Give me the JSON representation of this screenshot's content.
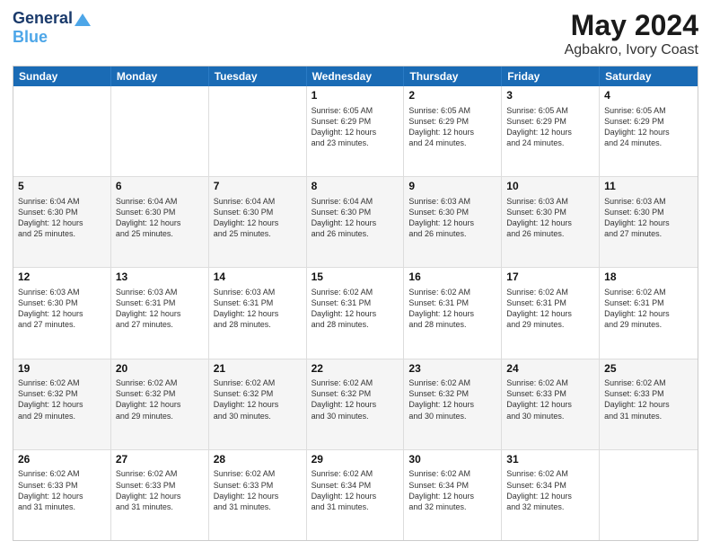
{
  "header": {
    "logo_line1": "General",
    "logo_line2": "Blue",
    "title": "May 2024",
    "subtitle": "Agbakro, Ivory Coast"
  },
  "weekdays": [
    "Sunday",
    "Monday",
    "Tuesday",
    "Wednesday",
    "Thursday",
    "Friday",
    "Saturday"
  ],
  "weeks": [
    [
      {
        "day": "",
        "info": ""
      },
      {
        "day": "",
        "info": ""
      },
      {
        "day": "",
        "info": ""
      },
      {
        "day": "1",
        "info": "Sunrise: 6:05 AM\nSunset: 6:29 PM\nDaylight: 12 hours\nand 23 minutes."
      },
      {
        "day": "2",
        "info": "Sunrise: 6:05 AM\nSunset: 6:29 PM\nDaylight: 12 hours\nand 24 minutes."
      },
      {
        "day": "3",
        "info": "Sunrise: 6:05 AM\nSunset: 6:29 PM\nDaylight: 12 hours\nand 24 minutes."
      },
      {
        "day": "4",
        "info": "Sunrise: 6:05 AM\nSunset: 6:29 PM\nDaylight: 12 hours\nand 24 minutes."
      }
    ],
    [
      {
        "day": "5",
        "info": "Sunrise: 6:04 AM\nSunset: 6:30 PM\nDaylight: 12 hours\nand 25 minutes."
      },
      {
        "day": "6",
        "info": "Sunrise: 6:04 AM\nSunset: 6:30 PM\nDaylight: 12 hours\nand 25 minutes."
      },
      {
        "day": "7",
        "info": "Sunrise: 6:04 AM\nSunset: 6:30 PM\nDaylight: 12 hours\nand 25 minutes."
      },
      {
        "day": "8",
        "info": "Sunrise: 6:04 AM\nSunset: 6:30 PM\nDaylight: 12 hours\nand 26 minutes."
      },
      {
        "day": "9",
        "info": "Sunrise: 6:03 AM\nSunset: 6:30 PM\nDaylight: 12 hours\nand 26 minutes."
      },
      {
        "day": "10",
        "info": "Sunrise: 6:03 AM\nSunset: 6:30 PM\nDaylight: 12 hours\nand 26 minutes."
      },
      {
        "day": "11",
        "info": "Sunrise: 6:03 AM\nSunset: 6:30 PM\nDaylight: 12 hours\nand 27 minutes."
      }
    ],
    [
      {
        "day": "12",
        "info": "Sunrise: 6:03 AM\nSunset: 6:30 PM\nDaylight: 12 hours\nand 27 minutes."
      },
      {
        "day": "13",
        "info": "Sunrise: 6:03 AM\nSunset: 6:31 PM\nDaylight: 12 hours\nand 27 minutes."
      },
      {
        "day": "14",
        "info": "Sunrise: 6:03 AM\nSunset: 6:31 PM\nDaylight: 12 hours\nand 28 minutes."
      },
      {
        "day": "15",
        "info": "Sunrise: 6:02 AM\nSunset: 6:31 PM\nDaylight: 12 hours\nand 28 minutes."
      },
      {
        "day": "16",
        "info": "Sunrise: 6:02 AM\nSunset: 6:31 PM\nDaylight: 12 hours\nand 28 minutes."
      },
      {
        "day": "17",
        "info": "Sunrise: 6:02 AM\nSunset: 6:31 PM\nDaylight: 12 hours\nand 29 minutes."
      },
      {
        "day": "18",
        "info": "Sunrise: 6:02 AM\nSunset: 6:31 PM\nDaylight: 12 hours\nand 29 minutes."
      }
    ],
    [
      {
        "day": "19",
        "info": "Sunrise: 6:02 AM\nSunset: 6:32 PM\nDaylight: 12 hours\nand 29 minutes."
      },
      {
        "day": "20",
        "info": "Sunrise: 6:02 AM\nSunset: 6:32 PM\nDaylight: 12 hours\nand 29 minutes."
      },
      {
        "day": "21",
        "info": "Sunrise: 6:02 AM\nSunset: 6:32 PM\nDaylight: 12 hours\nand 30 minutes."
      },
      {
        "day": "22",
        "info": "Sunrise: 6:02 AM\nSunset: 6:32 PM\nDaylight: 12 hours\nand 30 minutes."
      },
      {
        "day": "23",
        "info": "Sunrise: 6:02 AM\nSunset: 6:32 PM\nDaylight: 12 hours\nand 30 minutes."
      },
      {
        "day": "24",
        "info": "Sunrise: 6:02 AM\nSunset: 6:33 PM\nDaylight: 12 hours\nand 30 minutes."
      },
      {
        "day": "25",
        "info": "Sunrise: 6:02 AM\nSunset: 6:33 PM\nDaylight: 12 hours\nand 31 minutes."
      }
    ],
    [
      {
        "day": "26",
        "info": "Sunrise: 6:02 AM\nSunset: 6:33 PM\nDaylight: 12 hours\nand 31 minutes."
      },
      {
        "day": "27",
        "info": "Sunrise: 6:02 AM\nSunset: 6:33 PM\nDaylight: 12 hours\nand 31 minutes."
      },
      {
        "day": "28",
        "info": "Sunrise: 6:02 AM\nSunset: 6:33 PM\nDaylight: 12 hours\nand 31 minutes."
      },
      {
        "day": "29",
        "info": "Sunrise: 6:02 AM\nSunset: 6:34 PM\nDaylight: 12 hours\nand 31 minutes."
      },
      {
        "day": "30",
        "info": "Sunrise: 6:02 AM\nSunset: 6:34 PM\nDaylight: 12 hours\nand 32 minutes."
      },
      {
        "day": "31",
        "info": "Sunrise: 6:02 AM\nSunset: 6:34 PM\nDaylight: 12 hours\nand 32 minutes."
      },
      {
        "day": "",
        "info": ""
      }
    ]
  ]
}
